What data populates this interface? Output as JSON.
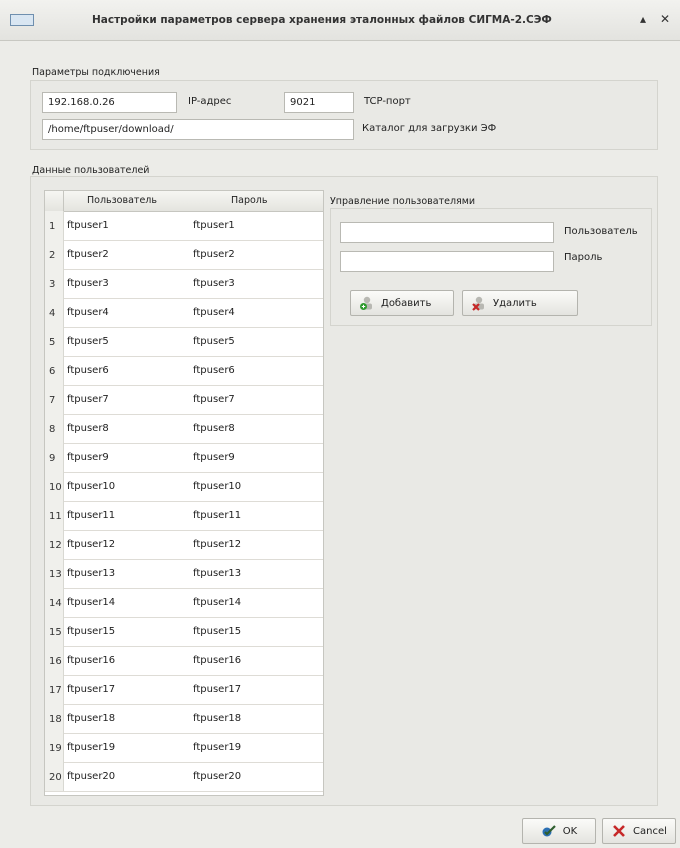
{
  "window": {
    "title": "Настройки параметров сервера хранения эталонных файлов СИГМА-2.СЭФ",
    "collapse": "▴",
    "close": "✕"
  },
  "connection": {
    "group_label": "Параметры подключения",
    "ip_value": "192.168.0.26",
    "ip_label": "IP-адрес",
    "port_value": "9021",
    "port_label": "TCP-порт",
    "dir_value": "/home/ftpuser/download/",
    "dir_label": "Каталог для загрузки ЭФ"
  },
  "users": {
    "group_label": "Данные пользователей",
    "col_user": "Пользователь",
    "col_pass": "Пароль",
    "rows": [
      {
        "n": "1",
        "user": "ftpuser1",
        "pass": "ftpuser1"
      },
      {
        "n": "2",
        "user": "ftpuser2",
        "pass": "ftpuser2"
      },
      {
        "n": "3",
        "user": "ftpuser3",
        "pass": "ftpuser3"
      },
      {
        "n": "4",
        "user": "ftpuser4",
        "pass": "ftpuser4"
      },
      {
        "n": "5",
        "user": "ftpuser5",
        "pass": "ftpuser5"
      },
      {
        "n": "6",
        "user": "ftpuser6",
        "pass": "ftpuser6"
      },
      {
        "n": "7",
        "user": "ftpuser7",
        "pass": "ftpuser7"
      },
      {
        "n": "8",
        "user": "ftpuser8",
        "pass": "ftpuser8"
      },
      {
        "n": "9",
        "user": "ftpuser9",
        "pass": "ftpuser9"
      },
      {
        "n": "10",
        "user": "ftpuser10",
        "pass": "ftpuser10"
      },
      {
        "n": "11",
        "user": "ftpuser11",
        "pass": "ftpuser11"
      },
      {
        "n": "12",
        "user": "ftpuser12",
        "pass": "ftpuser12"
      },
      {
        "n": "13",
        "user": "ftpuser13",
        "pass": "ftpuser13"
      },
      {
        "n": "14",
        "user": "ftpuser14",
        "pass": "ftpuser14"
      },
      {
        "n": "15",
        "user": "ftpuser15",
        "pass": "ftpuser15"
      },
      {
        "n": "16",
        "user": "ftpuser16",
        "pass": "ftpuser16"
      },
      {
        "n": "17",
        "user": "ftpuser17",
        "pass": "ftpuser17"
      },
      {
        "n": "18",
        "user": "ftpuser18",
        "pass": "ftpuser18"
      },
      {
        "n": "19",
        "user": "ftpuser19",
        "pass": "ftpuser19"
      },
      {
        "n": "20",
        "user": "ftpuser20",
        "pass": "ftpuser20"
      }
    ]
  },
  "management": {
    "group_label": "Управление пользователями",
    "user_value": "",
    "user_label": "Пользователь",
    "pass_value": "",
    "pass_label": "Пароль",
    "add_label": "Добавить",
    "delete_label": "Удалить"
  },
  "footer": {
    "ok_label": "OK",
    "cancel_label": "Cancel"
  },
  "colors": {
    "add_icon": "#2e9a2e",
    "delete_icon": "#c62828",
    "ok_icon": "#2b6fb3",
    "cancel_icon": "#c62828"
  }
}
